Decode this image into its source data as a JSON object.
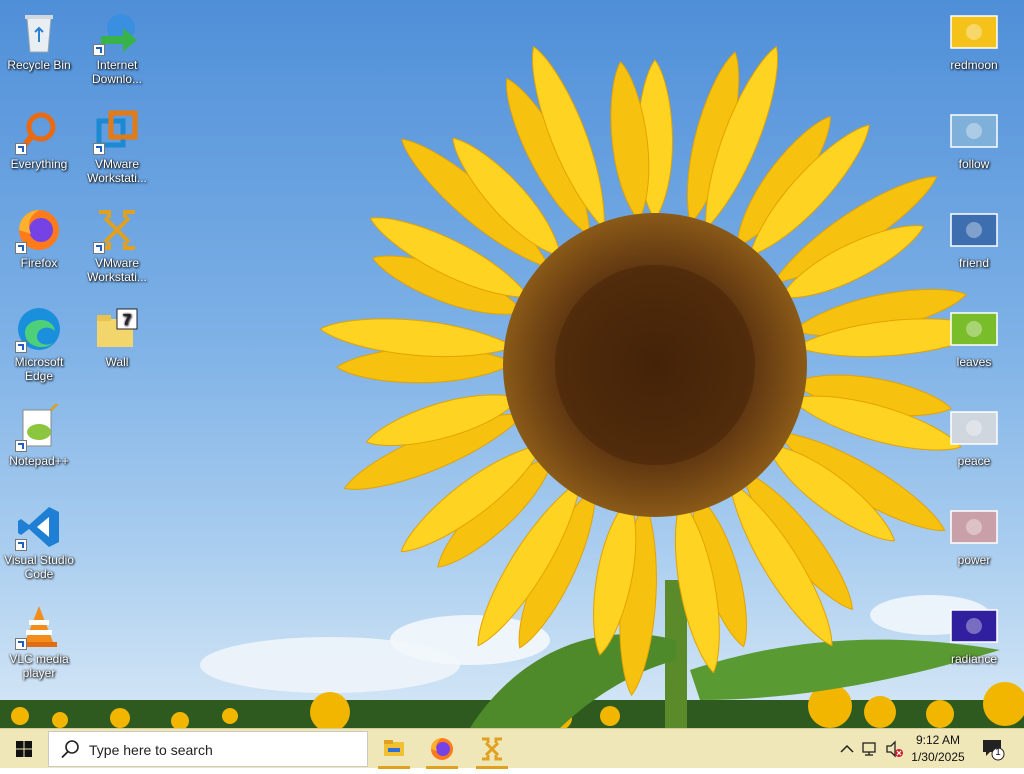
{
  "desktop": {
    "left_icons": [
      {
        "label": "Recycle Bin",
        "icon": "recycle-bin-icon"
      },
      {
        "label": "Internet Downlo...",
        "icon": "idm-icon"
      },
      {
        "label": "Everything",
        "icon": "everything-icon"
      },
      {
        "label": "VMware Workstati...",
        "icon": "vmware-icon"
      },
      {
        "label": "Firefox",
        "icon": "firefox-icon"
      },
      {
        "label": "VMware Workstati...",
        "icon": "vmware-player-icon"
      },
      {
        "label": "Microsoft Edge",
        "icon": "edge-icon"
      },
      {
        "label": "Wall",
        "icon": "folder-icon"
      },
      {
        "label": "Notepad++",
        "icon": "notepadpp-icon"
      },
      {
        "label": "Visual Studio Code",
        "icon": "vscode-icon"
      },
      {
        "label": "VLC media player",
        "icon": "vlc-icon"
      }
    ],
    "right_icons": [
      {
        "label": "redmoon",
        "icon": "image-thumb-icon"
      },
      {
        "label": "follow",
        "icon": "image-thumb-icon"
      },
      {
        "label": "friend",
        "icon": "image-thumb-icon"
      },
      {
        "label": "leaves",
        "icon": "image-thumb-icon"
      },
      {
        "label": "peace",
        "icon": "image-thumb-icon"
      },
      {
        "label": "power",
        "icon": "image-thumb-icon"
      },
      {
        "label": "radiance",
        "icon": "image-thumb-icon"
      }
    ]
  },
  "taskbar": {
    "search_placeholder": "Type here to search",
    "pinned": [
      "file-explorer-icon",
      "firefox-icon",
      "vmware-icon"
    ],
    "time": "9:12 AM",
    "date": "1/30/2025",
    "notification_count": "1"
  },
  "colors": {
    "taskbar_bg": "#f0e7b8",
    "accent": "#e0a020"
  }
}
